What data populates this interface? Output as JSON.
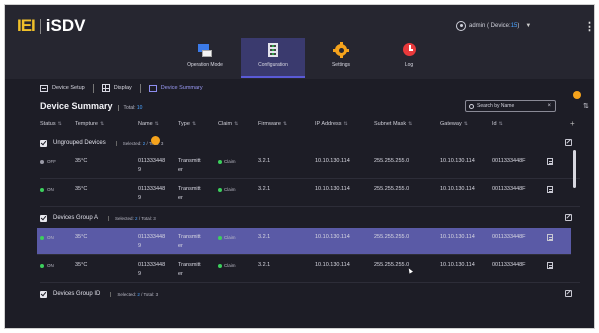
{
  "app": {
    "logo_left": "IEI",
    "logo_right": "iSDV"
  },
  "user": {
    "label_prefix": "admin ( Device: ",
    "device_count": "15",
    "label_suffix": " )"
  },
  "nav": {
    "tabs": [
      {
        "label": "Operation Mode",
        "icon": "operation-mode-icon",
        "active": false
      },
      {
        "label": "Configuration",
        "icon": "configuration-icon",
        "active": true
      },
      {
        "label": "Settings",
        "icon": "settings-icon",
        "active": false
      },
      {
        "label": "Log",
        "icon": "log-icon",
        "active": false
      }
    ]
  },
  "subbar": {
    "device_setup": "Device Setup",
    "display": "Display",
    "device_summary": "Device Summary"
  },
  "summary": {
    "title": "Device Summary",
    "total_label": "Total: ",
    "total_value": "10",
    "search_placeholder": "Search by Name"
  },
  "columns": [
    "Status",
    "Tempture",
    "Name",
    "Type",
    "Claim",
    "Firmware",
    "IP Address",
    "Subnet Mask",
    "Gateway",
    "Id"
  ],
  "groups": [
    {
      "name": "Ungrouped Devices",
      "selected_label": "Selected: ",
      "selected": "2",
      "total_label": " / Total: ",
      "total": "3"
    },
    {
      "name": "Devices Group A",
      "selected_label": "Selected: ",
      "selected": "2",
      "total_label": " / Total: ",
      "total": "3"
    },
    {
      "name": "Devices Group ID",
      "selected_label": "Selected: ",
      "selected": "2",
      "total_label": " / Total: ",
      "total": "3"
    }
  ],
  "rows": [
    {
      "status": "OFF",
      "temp": "35°C",
      "name": "0113334489",
      "type": "Transmitter",
      "claim": "Claim",
      "firmware": "3.2.1",
      "ip": "10.10.130.114",
      "mask": "255.255.255.0",
      "gateway": "10.10.130.114",
      "id": "0011333448F"
    },
    {
      "status": "ON",
      "temp": "35°C",
      "name": "0113334489",
      "type": "Transmitter",
      "claim": "Claim",
      "firmware": "3.2.1",
      "ip": "10.10.130.114",
      "mask": "255.255.255.0",
      "gateway": "10.10.130.114",
      "id": "0011333448F"
    },
    {
      "status": "ON",
      "temp": "35°C",
      "name": "0113334489",
      "type": "Transmitter",
      "claim": "Claim",
      "firmware": "3.2.1",
      "ip": "10.10.130.114",
      "mask": "255.255.255.0",
      "gateway": "10.10.130.114",
      "id": "0011333448F"
    },
    {
      "status": "ON",
      "temp": "35°C",
      "name": "0113334489",
      "type": "Transmitter",
      "claim": "Claim",
      "firmware": "3.2.1",
      "ip": "10.10.130.114",
      "mask": "255.255.255.0",
      "gateway": "10.10.130.114",
      "id": "0011333448F"
    }
  ],
  "colors": {
    "accent": "#5a5aa6",
    "status_on": "#3ccf5c",
    "status_off": "#9a9aa6",
    "brand_yellow": "#f0c02a",
    "link_blue": "#4aa3ff",
    "highlight_orange": "#f5a31c"
  }
}
